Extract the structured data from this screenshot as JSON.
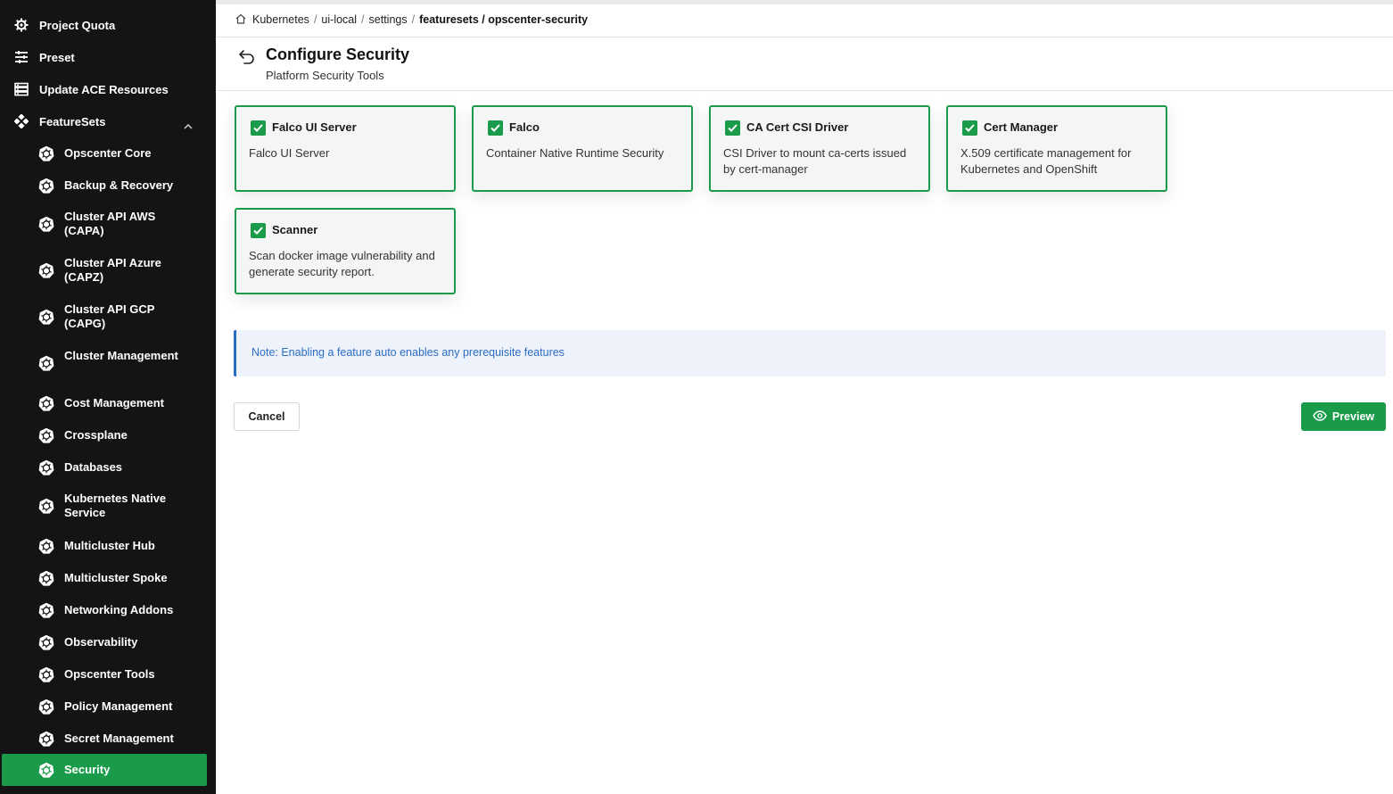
{
  "sidebar": {
    "top_items": [
      {
        "label": "Project Quota",
        "icon": "gear-icon"
      },
      {
        "label": "Preset",
        "icon": "sliders-icon"
      },
      {
        "label": "Update ACE Resources",
        "icon": "server-icon"
      },
      {
        "label": "FeatureSets",
        "icon": "featuresets-icon",
        "expanded": true
      }
    ],
    "featuresets": [
      {
        "label": "Opscenter Core"
      },
      {
        "label": "Backup & Recovery"
      },
      {
        "label": "Cluster API AWS (CAPA)"
      },
      {
        "label": "Cluster API Azure (CAPZ)"
      },
      {
        "label": "Cluster API GCP (CAPG)"
      },
      {
        "label": "Cluster Management"
      },
      {
        "label": "Cost Management"
      },
      {
        "label": "Crossplane"
      },
      {
        "label": "Databases"
      },
      {
        "label": "Kubernetes Native Service"
      },
      {
        "label": "Multicluster Hub"
      },
      {
        "label": "Multicluster Spoke"
      },
      {
        "label": "Networking Addons"
      },
      {
        "label": "Observability"
      },
      {
        "label": "Opscenter Tools"
      },
      {
        "label": "Policy Management"
      },
      {
        "label": "Secret Management"
      },
      {
        "label": "Security",
        "active": true
      }
    ]
  },
  "breadcrumb": [
    "Kubernetes",
    "ui-local",
    "settings",
    "featuresets / opscenter-security"
  ],
  "header": {
    "title": "Configure Security",
    "subtitle": "Platform Security Tools"
  },
  "features": [
    {
      "name": "Falco UI Server",
      "description": "Falco UI Server",
      "checked": true
    },
    {
      "name": "Falco",
      "description": "Container Native Runtime Security",
      "checked": true
    },
    {
      "name": "CA Cert CSI Driver",
      "description": "CSI Driver to mount ca-certs issued by cert-manager",
      "checked": true
    },
    {
      "name": "Cert Manager",
      "description": "X.509 certificate management for Kubernetes and OpenShift",
      "checked": true
    },
    {
      "name": "Scanner",
      "description": "Scan docker image vulnerability and generate security report.",
      "checked": true
    }
  ],
  "note": "Note: Enabling a feature auto enables any prerequisite features",
  "actions": {
    "cancel_label": "Cancel",
    "preview_label": "Preview"
  },
  "colors": {
    "accent": "#1a9b4a",
    "sidebar_bg": "#141414",
    "note_text": "#2b6cc4",
    "note_bg": "#eef3fb"
  }
}
